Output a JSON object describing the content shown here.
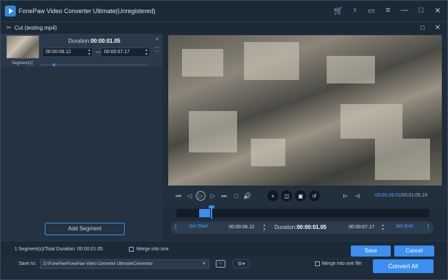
{
  "app": {
    "title": "FonePaw Video Converter Ultimate(Unregistered)"
  },
  "titlebar_icons": [
    "cart-icon",
    "key-icon",
    "chat-icon",
    "menu-icon",
    "minimize-icon",
    "maximize-icon",
    "close-icon"
  ],
  "titlebar_glyphs": [
    "🛒",
    "♀",
    "▭",
    "≡",
    "—",
    "□",
    "✕"
  ],
  "cut_window": {
    "title": "Cut (testing.mp4)"
  },
  "segment": {
    "label": "Segment[1]",
    "duration_label": "Duration:",
    "duration_value": "00:00:01.05",
    "start": "00:00:06.12",
    "end": "00:00:07.17",
    "dash": "—"
  },
  "add_segment_label": "Add Segment",
  "player": {
    "current_time": "00:00:09.01",
    "total_time": "00:01:05.19",
    "progress": 0.138
  },
  "editbar": {
    "set_start": "Set Start",
    "start_time": "00:00:06.12",
    "duration_label": "Duration:",
    "duration_value": "00:00:01.05",
    "end_time": "00:00:07.17",
    "set_end": "Set End"
  },
  "footer": {
    "total_duration": "1 Segment(s)/Total Duration: 00:00:01.05",
    "merge_into_one": "Merge into one",
    "save": "Save",
    "cancel": "Cancel",
    "save_to_label": "Save to:",
    "save_path": "D:\\FonePaw\\FonePaw Video Converter Ultimate\\Converted",
    "merge_into_one_file": "Merge into one file",
    "convert_all": "Convert All"
  },
  "colors": {
    "accent": "#3b8ff0",
    "background": "#1f2c3a"
  }
}
